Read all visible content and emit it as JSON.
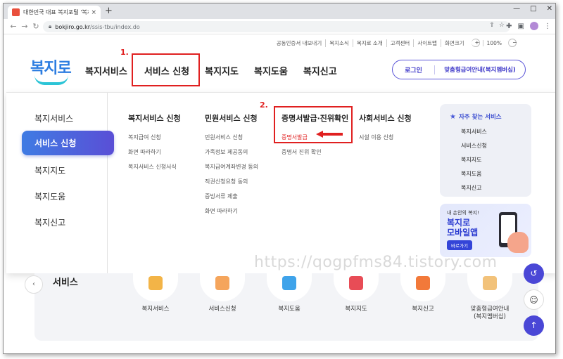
{
  "browser": {
    "tab_title": "대한민국 대표 복지포털 '복지로'",
    "tab_close": "×",
    "new_tab": "+",
    "url_host": "bokjiro.go.kr",
    "url_path": "/ssis-tbu/index.do",
    "window_controls": [
      "—",
      "□",
      "✕"
    ]
  },
  "util": {
    "items": [
      "공동인증서 내보내기",
      "복지소식",
      "복지로 소개",
      "고객센터",
      "사이트맵",
      "화면크기"
    ],
    "zoom_minus": "−",
    "zoom_plus": "+",
    "zoom_level": "100%"
  },
  "header": {
    "logo_text": "복지로",
    "gnb": [
      "복지서비스",
      "서비스 신청",
      "복지지도",
      "복지도움",
      "복지신고"
    ],
    "login": "로그인",
    "guide": "맞춤형급여안내(복지멤버십)"
  },
  "annotations": {
    "step1": "1.",
    "step2": "2."
  },
  "megamenu": {
    "left_nav": [
      "복지서비스",
      "서비스 신청",
      "복지지도",
      "복지도움",
      "복지신고"
    ],
    "left_active": "서비스 신청",
    "columns": [
      {
        "title": "복지서비스 신청",
        "links": [
          "복지급여 신청",
          "화면 따라하기",
          "복지서비스 신청서식"
        ]
      },
      {
        "title": "민원서비스 신청",
        "links": [
          "민원서비스 신청",
          "가족정보 제공동의",
          "복지급여계좌변경 동의",
          "직권신청요청 동의",
          "증빙서류 제출",
          "화면 따라하기"
        ]
      },
      {
        "title": "증명서발급·진위확인",
        "links": [
          "증명서발급",
          "증명서 진위 확인"
        ]
      },
      {
        "title": "사회서비스 신청",
        "links": [
          "시설 이용 신청"
        ]
      }
    ],
    "favorites": {
      "title": "자주 찾는 서비스",
      "items": [
        "복지서비스",
        "서비스신청",
        "복지지도",
        "복지도움",
        "복지신고"
      ]
    },
    "banner": {
      "line1": "내 손안의 복지!",
      "line2": "복지로",
      "line3": "모바일앱",
      "button": "바로가기",
      "app_badge": "복지로"
    }
  },
  "services": {
    "title": "서비스",
    "prev": "‹",
    "items": [
      "복지서비스",
      "서비스신청",
      "복지도움",
      "복지지도",
      "복지신고",
      "맞춤형급여안내\n(복지멤버십)"
    ]
  },
  "watermark": "https://qogpfms84.tistory.com"
}
